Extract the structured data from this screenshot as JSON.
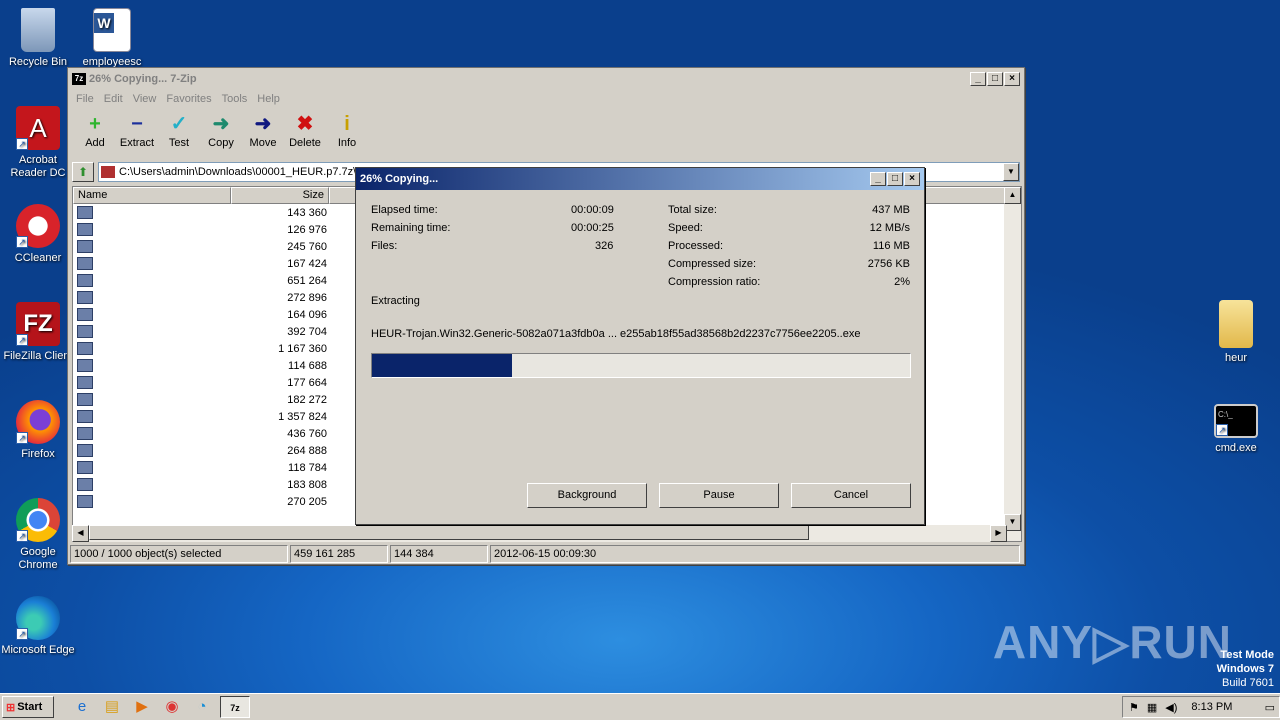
{
  "desktop": {
    "icons": [
      {
        "label": "Recycle Bin"
      },
      {
        "label": "employeesc"
      },
      {
        "label": "Acrobat Reader DC"
      },
      {
        "label": "CCleaner"
      },
      {
        "label": "FileZilla Client"
      },
      {
        "label": "Firefox"
      },
      {
        "label": "Google Chrome"
      },
      {
        "label": "Microsoft Edge"
      },
      {
        "label": "heur"
      },
      {
        "label": "cmd.exe"
      }
    ]
  },
  "main_window": {
    "title": "26% Copying... 7-Zip",
    "app_icon": "7z",
    "menu": [
      "File",
      "Edit",
      "View",
      "Favorites",
      "Tools",
      "Help"
    ],
    "toolbar": [
      {
        "label": "Add",
        "icon": "+",
        "color": "#2fb52f"
      },
      {
        "label": "Extract",
        "icon": "−",
        "color": "#1c2f9c"
      },
      {
        "label": "Test",
        "icon": "✓",
        "color": "#24b0c8"
      },
      {
        "label": "Copy",
        "icon": "➜",
        "color": "#1e8a6e"
      },
      {
        "label": "Move",
        "icon": "➜",
        "color": "#101880"
      },
      {
        "label": "Delete",
        "icon": "✖",
        "color": "#d01010"
      },
      {
        "label": "Info",
        "icon": "i",
        "color": "#c8a000"
      }
    ],
    "address": "C:\\Users\\admin\\Downloads\\00001_HEUR.p7.7z\\",
    "columns": {
      "name": "Name",
      "size": "Size"
    },
    "rows": [
      "143 360",
      "126 976",
      "245 760",
      "167 424",
      "651 264",
      "272 896",
      "164 096",
      "392 704",
      "1 167 360",
      "114 688",
      "177 664",
      "182 272",
      "1 357 824",
      "436 760",
      "264 888",
      "118 784",
      "183 808",
      "270 205"
    ],
    "status": [
      "1000 / 1000 object(s) selected",
      "459 161 285",
      "144 384",
      "2012-06-15 00:09:30"
    ]
  },
  "progress_dialog": {
    "title": "26% Copying...",
    "elapsed_label": "Elapsed time:",
    "elapsed": "00:00:09",
    "remaining_label": "Remaining time:",
    "remaining": "00:00:25",
    "files_label": "Files:",
    "files": "326",
    "total_label": "Total size:",
    "total": "437 MB",
    "speed_label": "Speed:",
    "speed": "12 MB/s",
    "processed_label": "Processed:",
    "processed": "116 MB",
    "compressed_label": "Compressed size:",
    "compressed": "2756 KB",
    "ratio_label": "Compression ratio:",
    "ratio": "2%",
    "action": "Extracting",
    "current_file": "HEUR-Trojan.Win32.Generic-5082a071a3fdb0a ... e255ab18f55ad38568b2d2237c7756ee2205..exe",
    "progress_fraction": 0.26,
    "buttons": {
      "background": "Background",
      "pause": "Pause",
      "cancel": "Cancel"
    }
  },
  "taskbar": {
    "start": "Start",
    "clock": "8:13 PM"
  },
  "watermark": "ANY▷RUN",
  "testmode": {
    "line1": "Test Mode",
    "line2": "Windows 7",
    "line3": "Build 7601"
  }
}
